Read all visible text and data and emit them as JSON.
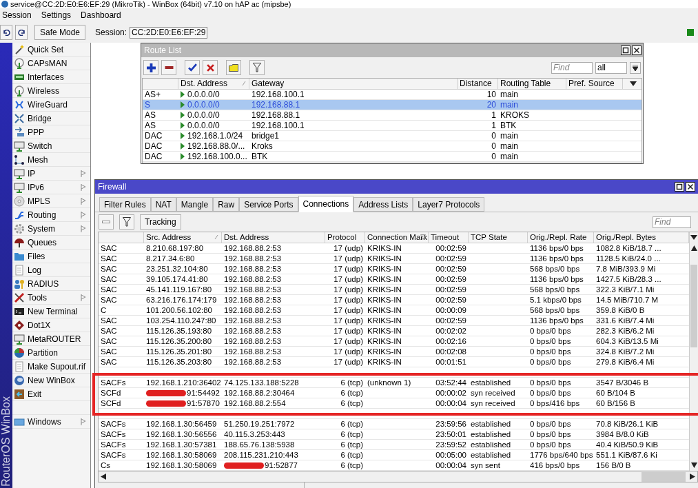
{
  "window": {
    "title": "service@CC:2D:E0:E6:EF:29 (MikroTik) - WinBox (64bit) v7.10 on hAP ac (mipsbe)"
  },
  "menu": [
    "Session",
    "Settings",
    "Dashboard"
  ],
  "toolbar": {
    "safe_mode": "Safe Mode",
    "session_label": "Session:",
    "session_value": "CC:2D:E0:E6:EF:29"
  },
  "side_brand": "RouterOS WinBox",
  "sidebar": {
    "items": [
      {
        "label": "Quick Set",
        "submenu": false
      },
      {
        "label": "CAPsMAN",
        "submenu": false
      },
      {
        "label": "Interfaces",
        "submenu": false
      },
      {
        "label": "Wireless",
        "submenu": false
      },
      {
        "label": "WireGuard",
        "submenu": false
      },
      {
        "label": "Bridge",
        "submenu": false
      },
      {
        "label": "PPP",
        "submenu": false
      },
      {
        "label": "Switch",
        "submenu": false
      },
      {
        "label": "Mesh",
        "submenu": false
      },
      {
        "label": "IP",
        "submenu": true
      },
      {
        "label": "IPv6",
        "submenu": true
      },
      {
        "label": "MPLS",
        "submenu": true
      },
      {
        "label": "Routing",
        "submenu": true
      },
      {
        "label": "System",
        "submenu": true
      },
      {
        "label": "Queues",
        "submenu": false
      },
      {
        "label": "Files",
        "submenu": false
      },
      {
        "label": "Log",
        "submenu": false
      },
      {
        "label": "RADIUS",
        "submenu": false
      },
      {
        "label": "Tools",
        "submenu": true
      },
      {
        "label": "New Terminal",
        "submenu": false
      },
      {
        "label": "Dot1X",
        "submenu": false
      },
      {
        "label": "MetaROUTER",
        "submenu": false
      },
      {
        "label": "Partition",
        "submenu": false
      },
      {
        "label": "Make Supout.rif",
        "submenu": false
      },
      {
        "label": "New WinBox",
        "submenu": false
      },
      {
        "label": "Exit",
        "submenu": false
      }
    ],
    "footer_items": [
      {
        "label": "Windows",
        "submenu": true
      }
    ]
  },
  "route_list": {
    "title": "Route List",
    "find_placeholder": "Find",
    "filter_value": "all",
    "columns": [
      {
        "label": "Dst. Address",
        "sorted_ascending": true
      },
      {
        "label": "Gateway"
      },
      {
        "label": "Distance"
      },
      {
        "label": "Routing Table"
      },
      {
        "label": "Pref. Source"
      }
    ],
    "rows": [
      {
        "flags": "AS+",
        "dst": "0.0.0.0/0",
        "gateway": "192.168.100.1",
        "distance": "10",
        "table": "main",
        "selected": false
      },
      {
        "flags": "S",
        "dst": "0.0.0.0/0",
        "gateway": "192.168.88.1",
        "distance": "20",
        "table": "main",
        "selected": true
      },
      {
        "flags": "AS",
        "dst": "0.0.0.0/0",
        "gateway": "192.168.88.1",
        "distance": "1",
        "table": "KROKS",
        "selected": false
      },
      {
        "flags": "AS",
        "dst": "0.0.0.0/0",
        "gateway": "192.168.100.1",
        "distance": "1",
        "table": "BTK",
        "selected": false
      },
      {
        "flags": "DAC",
        "dst": "192.168.1.0/24",
        "gateway": "bridge1",
        "distance": "0",
        "table": "main",
        "selected": false
      },
      {
        "flags": "DAC",
        "dst": "192.168.88.0/...",
        "gateway": "Kroks",
        "distance": "0",
        "table": "main",
        "selected": false
      },
      {
        "flags": "DAC",
        "dst": "192.168.100.0...",
        "gateway": "BTK",
        "distance": "0",
        "table": "main",
        "selected": false
      }
    ]
  },
  "firewall": {
    "title": "Firewall",
    "tabs": [
      {
        "label": "Filter Rules",
        "selected": false
      },
      {
        "label": "NAT",
        "selected": false
      },
      {
        "label": "Mangle",
        "selected": false
      },
      {
        "label": "Raw",
        "selected": false
      },
      {
        "label": "Service Ports",
        "selected": false
      },
      {
        "label": "Connections",
        "selected": true
      },
      {
        "label": "Address Lists",
        "selected": false
      },
      {
        "label": "Layer7 Protocols",
        "selected": false
      }
    ],
    "tracking_button": "Tracking",
    "find_placeholder": "Find",
    "columns": [
      {
        "label": "Src. Address",
        "sorted_ascending": true
      },
      {
        "label": "Dst. Address"
      },
      {
        "label": "Protocol"
      },
      {
        "label": "Connection Mark",
        "sorted_descending": true
      },
      {
        "label": "Timeout"
      },
      {
        "label": "TCP State"
      },
      {
        "label": "Orig./Repl. Rate"
      },
      {
        "label": "Orig./Repl. Bytes"
      }
    ],
    "rows": [
      {
        "kind": "entry",
        "flags": "SAC",
        "src": "8.210.68.197:80",
        "dst": "192.168.88.2:53",
        "protocol": "17 (udp)",
        "mark": "KRIKS-IN",
        "timeout": "00:02:59",
        "rate": "1136 bps/0 bps",
        "bytes": "1082.8 KiB/18.7 ..."
      },
      {
        "kind": "entry",
        "flags": "SAC",
        "src": "8.217.34.6:80",
        "dst": "192.168.88.2:53",
        "protocol": "17 (udp)",
        "mark": "KRIKS-IN",
        "timeout": "00:02:59",
        "rate": "1136 bps/0 bps",
        "bytes": "1128.5 KiB/24.0 ..."
      },
      {
        "kind": "entry",
        "flags": "SAC",
        "src": "23.251.32.104:80",
        "dst": "192.168.88.2:53",
        "protocol": "17 (udp)",
        "mark": "KRIKS-IN",
        "timeout": "00:02:59",
        "rate": "568 bps/0 bps",
        "bytes": "7.8 MiB/393.9 Mi"
      },
      {
        "kind": "entry",
        "flags": "SAC",
        "src": "39.105.174.41:80",
        "dst": "192.168.88.2:53",
        "protocol": "17 (udp)",
        "mark": "KRIKS-IN",
        "timeout": "00:02:59",
        "rate": "1136 bps/0 bps",
        "bytes": "1427.5 KiB/28.3 ..."
      },
      {
        "kind": "entry",
        "flags": "SAC",
        "src": "45.141.119.167:80",
        "dst": "192.168.88.2:53",
        "protocol": "17 (udp)",
        "mark": "KRIKS-IN",
        "timeout": "00:02:59",
        "rate": "568 bps/0 bps",
        "bytes": "322.3 KiB/7.1 Mi"
      },
      {
        "kind": "entry",
        "flags": "SAC",
        "src": "63.216.176.174:179",
        "dst": "192.168.88.2:53",
        "protocol": "17 (udp)",
        "mark": "KRIKS-IN",
        "timeout": "00:02:59",
        "rate": "5.1 kbps/0 bps",
        "bytes": "14.5 MiB/710.7 M"
      },
      {
        "kind": "entry",
        "flags": "C",
        "src": "101.200.56.102:80",
        "dst": "192.168.88.2:53",
        "protocol": "17 (udp)",
        "mark": "KRIKS-IN",
        "timeout": "00:00:09",
        "rate": "568 bps/0 bps",
        "bytes": "359.8 KiB/0 B"
      },
      {
        "kind": "entry",
        "flags": "SAC",
        "src": "103.254.110.247:80",
        "dst": "192.168.88.2:53",
        "protocol": "17 (udp)",
        "mark": "KRIKS-IN",
        "timeout": "00:02:59",
        "rate": "1136 bps/0 bps",
        "bytes": "331.6 KiB/7.4 Mi"
      },
      {
        "kind": "entry",
        "flags": "SAC",
        "src": "115.126.35.193:80",
        "dst": "192.168.88.2:53",
        "protocol": "17 (udp)",
        "mark": "KRIKS-IN",
        "timeout": "00:02:02",
        "rate": "0 bps/0 bps",
        "bytes": "282.3 KiB/6.2 Mi"
      },
      {
        "kind": "entry",
        "flags": "SAC",
        "src": "115.126.35.200:80",
        "dst": "192.168.88.2:53",
        "protocol": "17 (udp)",
        "mark": "KRIKS-IN",
        "timeout": "00:02:16",
        "rate": "0 bps/0 bps",
        "bytes": "604.3 KiB/13.5 Mi"
      },
      {
        "kind": "entry",
        "flags": "SAC",
        "src": "115.126.35.201:80",
        "dst": "192.168.88.2:53",
        "protocol": "17 (udp)",
        "mark": "KRIKS-IN",
        "timeout": "00:02:08",
        "rate": "0 bps/0 bps",
        "bytes": "324.8 KiB/7.2 Mi"
      },
      {
        "kind": "entry",
        "flags": "SAC",
        "src": "115.126.35.203:80",
        "dst": "192.168.88.2:53",
        "protocol": "17 (udp)",
        "mark": "KRIKS-IN",
        "timeout": "00:01:51",
        "rate": "0 bps/0 bps",
        "bytes": "279.8 KiB/6.4 Mi"
      },
      {
        "kind": "obscured"
      },
      {
        "kind": "entry",
        "flags": "SACFs",
        "src": "192.168.1.210:36402",
        "dst": "74.125.133.188:5228",
        "protocol": "6 (tcp)",
        "mark": "(unknown 1)",
        "timeout": "03:52:44",
        "tcp_state": "established",
        "rate": "0 bps/0 bps",
        "bytes": "3547 B/3046 B"
      },
      {
        "kind": "entry",
        "flags": "SCFd",
        "src": "91:54492",
        "src_redacted": true,
        "dst": "192.168.88.2:30464",
        "protocol": "6 (tcp)",
        "timeout": "00:00:02",
        "tcp_state": "syn received",
        "rate": "0 bps/0 bps",
        "bytes": "60 B/104 B"
      },
      {
        "kind": "entry",
        "flags": "SCFd",
        "src": "91:57870",
        "src_redacted": true,
        "dst": "192.168.88.2:554",
        "protocol": "6 (tcp)",
        "timeout": "00:00:04",
        "tcp_state": "syn received",
        "rate": "0 bps/416 bps",
        "bytes": "60 B/156 B"
      },
      {
        "kind": "obscured"
      },
      {
        "kind": "entry",
        "flags": "SACFs",
        "src": "192.168.1.30:56459",
        "dst": "51.250.19.251:7972",
        "protocol": "6 (tcp)",
        "timeout": "23:59:56",
        "tcp_state": "established",
        "rate": "0 bps/0 bps",
        "bytes": "70.8 KiB/26.1 KiB"
      },
      {
        "kind": "entry",
        "flags": "SACFs",
        "src": "192.168.1.30:56556",
        "dst": "40.115.3.253:443",
        "protocol": "6 (tcp)",
        "timeout": "23:50:01",
        "tcp_state": "established",
        "rate": "0 bps/0 bps",
        "bytes": "3984 B/8.0 KiB"
      },
      {
        "kind": "entry",
        "flags": "SACFs",
        "src": "192.168.1.30:57381",
        "dst": "188.65.76.138:5938",
        "protocol": "6 (tcp)",
        "timeout": "23:59:52",
        "tcp_state": "established",
        "rate": "0 bps/0 bps",
        "bytes": "40.4 KiB/50.9 KiB"
      },
      {
        "kind": "entry",
        "flags": "SACFs",
        "src": "192.168.1.30:58069",
        "dst": "208.115.231.210:443",
        "protocol": "6 (tcp)",
        "timeout": "00:05:00",
        "tcp_state": "established",
        "rate": "1776 bps/640 bps",
        "bytes": "551.1 KiB/87.6 Ki"
      },
      {
        "kind": "entry",
        "flags": "Cs",
        "src": "192.168.1.30:58069",
        "dst": "91:52877",
        "dst_redacted": true,
        "protocol": "6 (tcp)",
        "timeout": "00:00:04",
        "tcp_state": "syn sent",
        "rate": "416 bps/0 bps",
        "bytes": "156 B/0 B"
      }
    ]
  },
  "annotation": {
    "kind": "rectangle"
  }
}
